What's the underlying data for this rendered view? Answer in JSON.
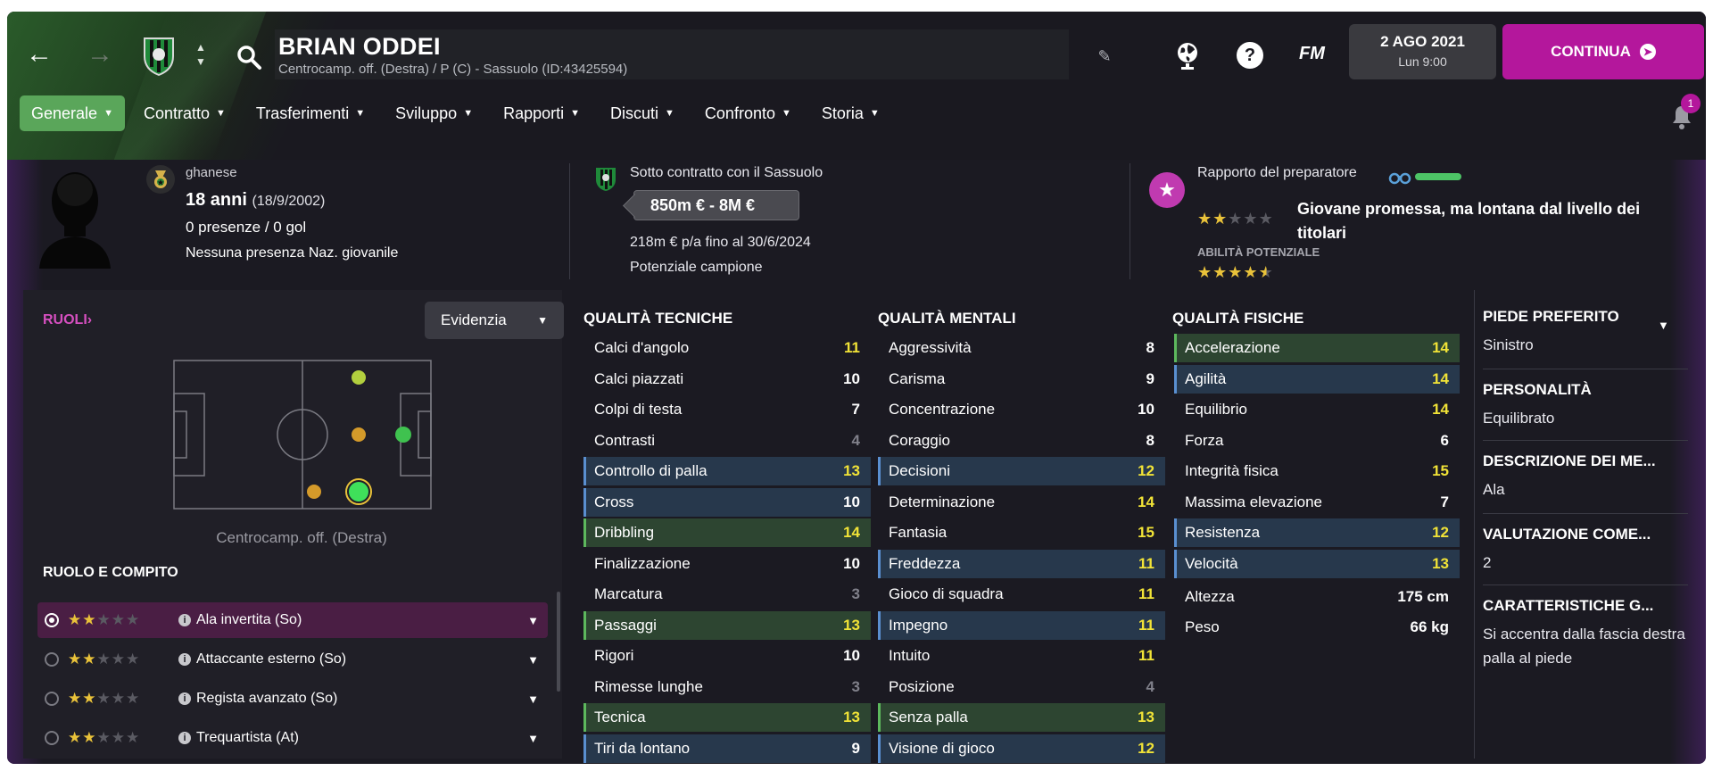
{
  "header": {
    "player_name": "BRIAN ODDEI",
    "subtitle": "Centrocamp. off. (Destra) / P (C) - Sassuolo (ID:43425594)",
    "fm_label": "FM",
    "date": "2 AGO 2021",
    "time": "Lun 9:00",
    "continue_label": "CONTINUA",
    "notification_count": "1",
    "club_colors": [
      "#1f8a3a",
      "#111111"
    ]
  },
  "tabs": [
    {
      "label": "Generale",
      "active": true
    },
    {
      "label": "Contratto"
    },
    {
      "label": "Trasferimenti"
    },
    {
      "label": "Sviluppo"
    },
    {
      "label": "Rapporti"
    },
    {
      "label": "Discuti"
    },
    {
      "label": "Confronto"
    },
    {
      "label": "Storia"
    }
  ],
  "profile": {
    "nationality": "ghanese",
    "age": "18 anni",
    "birth": "(18/9/2002)",
    "appearances": "0 presenze / 0 gol",
    "youth_caps": "Nessuna presenza Naz. giovanile"
  },
  "contract": {
    "title": "Sotto contratto con il Sassuolo",
    "value_range": "850m € - 8M €",
    "wage": "218m € p/a fino al 30/6/2024",
    "potential": "Potenziale campione"
  },
  "scout": {
    "title": "Rapporto del preparatore",
    "current_stars": 2,
    "description": "Giovane promessa, ma lontana dal livello dei titolari",
    "potential_label": "ABILITÀ POTENZIALE",
    "potential_stars": 4.5,
    "accent": "#c03ab0"
  },
  "roles": {
    "label": "RUOLI",
    "highlight_button": "Evidenzia",
    "position_label": "Centrocamp. off. (Destra)",
    "role_task_label": "RUOLO E COMPITO",
    "items": [
      {
        "name": "Ala invertita (So)",
        "stars": 2,
        "selected": true
      },
      {
        "name": "Attaccante esterno (So)",
        "stars": 2
      },
      {
        "name": "Regista avanzato (So)",
        "stars": 2
      },
      {
        "name": "Trequartista (At)",
        "stars": 2
      }
    ]
  },
  "technical": {
    "title": "QUALITÀ TECNICHE",
    "items": [
      {
        "name": "Calci d'angolo",
        "value": "11",
        "hl": ""
      },
      {
        "name": "Calci piazzati",
        "value": "10",
        "hl": ""
      },
      {
        "name": "Colpi di testa",
        "value": "7",
        "hl": ""
      },
      {
        "name": "Contrasti",
        "value": "4",
        "hl": ""
      },
      {
        "name": "Controllo di palla",
        "value": "13",
        "hl": "b"
      },
      {
        "name": "Cross",
        "value": "10",
        "hl": "b"
      },
      {
        "name": "Dribbling",
        "value": "14",
        "hl": "g"
      },
      {
        "name": "Finalizzazione",
        "value": "10",
        "hl": ""
      },
      {
        "name": "Marcatura",
        "value": "3",
        "hl": ""
      },
      {
        "name": "Passaggi",
        "value": "13",
        "hl": "g"
      },
      {
        "name": "Rigori",
        "value": "10",
        "hl": ""
      },
      {
        "name": "Rimesse lunghe",
        "value": "3",
        "hl": ""
      },
      {
        "name": "Tecnica",
        "value": "13",
        "hl": "g"
      },
      {
        "name": "Tiri da lontano",
        "value": "9",
        "hl": "b"
      }
    ]
  },
  "mental": {
    "title": "QUALITÀ MENTALI",
    "items": [
      {
        "name": "Aggressività",
        "value": "8",
        "hl": ""
      },
      {
        "name": "Carisma",
        "value": "9",
        "hl": ""
      },
      {
        "name": "Concentrazione",
        "value": "10",
        "hl": ""
      },
      {
        "name": "Coraggio",
        "value": "8",
        "hl": ""
      },
      {
        "name": "Decisioni",
        "value": "12",
        "hl": "b"
      },
      {
        "name": "Determinazione",
        "value": "14",
        "hl": ""
      },
      {
        "name": "Fantasia",
        "value": "15",
        "hl": ""
      },
      {
        "name": "Freddezza",
        "value": "11",
        "hl": "b"
      },
      {
        "name": "Gioco di squadra",
        "value": "11",
        "hl": ""
      },
      {
        "name": "Impegno",
        "value": "11",
        "hl": "b"
      },
      {
        "name": "Intuito",
        "value": "11",
        "hl": ""
      },
      {
        "name": "Posizione",
        "value": "4",
        "hl": ""
      },
      {
        "name": "Senza palla",
        "value": "13",
        "hl": "g"
      },
      {
        "name": "Visione di gioco",
        "value": "12",
        "hl": "b"
      }
    ]
  },
  "physical": {
    "title": "QUALITÀ FISICHE",
    "items": [
      {
        "name": "Accelerazione",
        "value": "14",
        "hl": "g"
      },
      {
        "name": "Agilità",
        "value": "14",
        "hl": "b"
      },
      {
        "name": "Equilibrio",
        "value": "14",
        "hl": ""
      },
      {
        "name": "Forza",
        "value": "6",
        "hl": ""
      },
      {
        "name": "Integrità fisica",
        "value": "15",
        "hl": ""
      },
      {
        "name": "Massima elevazione",
        "value": "7",
        "hl": ""
      },
      {
        "name": "Resistenza",
        "value": "12",
        "hl": "b"
      },
      {
        "name": "Velocità",
        "value": "13",
        "hl": "b"
      }
    ],
    "height_label": "Altezza",
    "height": "175 cm",
    "weight_label": "Peso",
    "weight": "66 kg"
  },
  "side": {
    "preferred_foot_title": "PIEDE PREFERITO",
    "preferred_foot": "Sinistro",
    "personality_title": "PERSONALITÀ",
    "personality": "Equilibrato",
    "media_title": "DESCRIZIONE DEI ME...",
    "media": "Ala",
    "rating_title": "VALUTAZIONE COME...",
    "rating": "2",
    "traits_title": "CARATTERISTICHE G...",
    "traits": "Si accentra dalla fascia destra palla al piede"
  }
}
